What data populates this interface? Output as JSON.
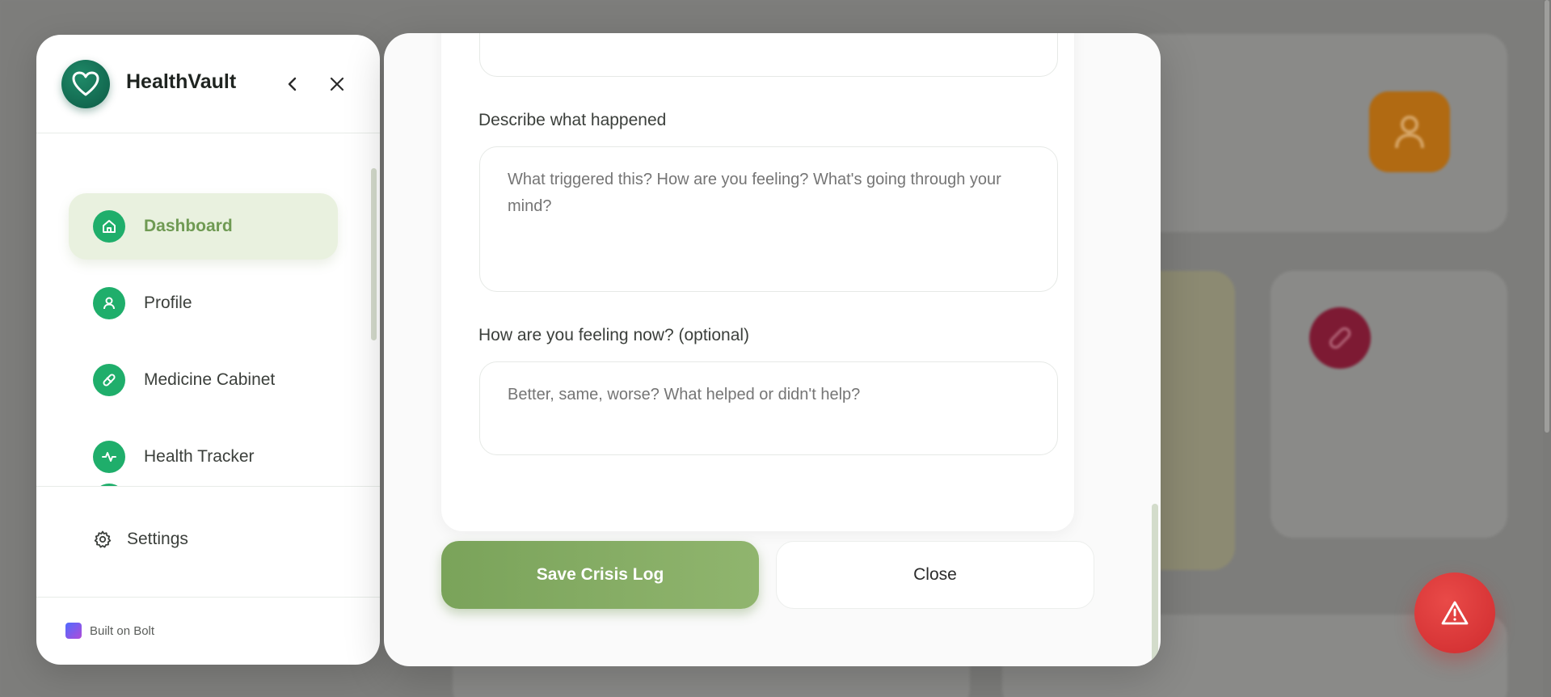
{
  "sidebar": {
    "brand": "HealthVault",
    "nav": [
      {
        "label": "Dashboard",
        "icon": "home-icon",
        "active": true
      },
      {
        "label": "Profile",
        "icon": "user-icon",
        "active": false
      },
      {
        "label": "Medicine Cabinet",
        "icon": "pill-icon",
        "active": false
      },
      {
        "label": "Health Tracker",
        "icon": "activity-icon",
        "active": false
      }
    ],
    "settings_label": "Settings",
    "built_on": "Built on Bolt"
  },
  "modal": {
    "describe_label": "Describe what happened",
    "describe_placeholder": "What triggered this? How are you feeling? What's going through your mind?",
    "feeling_label": "How are you feeling now? (optional)",
    "feeling_placeholder": "Better, same, worse? What helped or didn't help?",
    "save_label": "Save Crisis Log",
    "close_label": "Close"
  },
  "colors": {
    "accent_green": "#7aa35a",
    "nav_icon_green": "#1fae6b",
    "brand_dark_green": "#0d5a45",
    "emergency_red": "#d93234"
  }
}
